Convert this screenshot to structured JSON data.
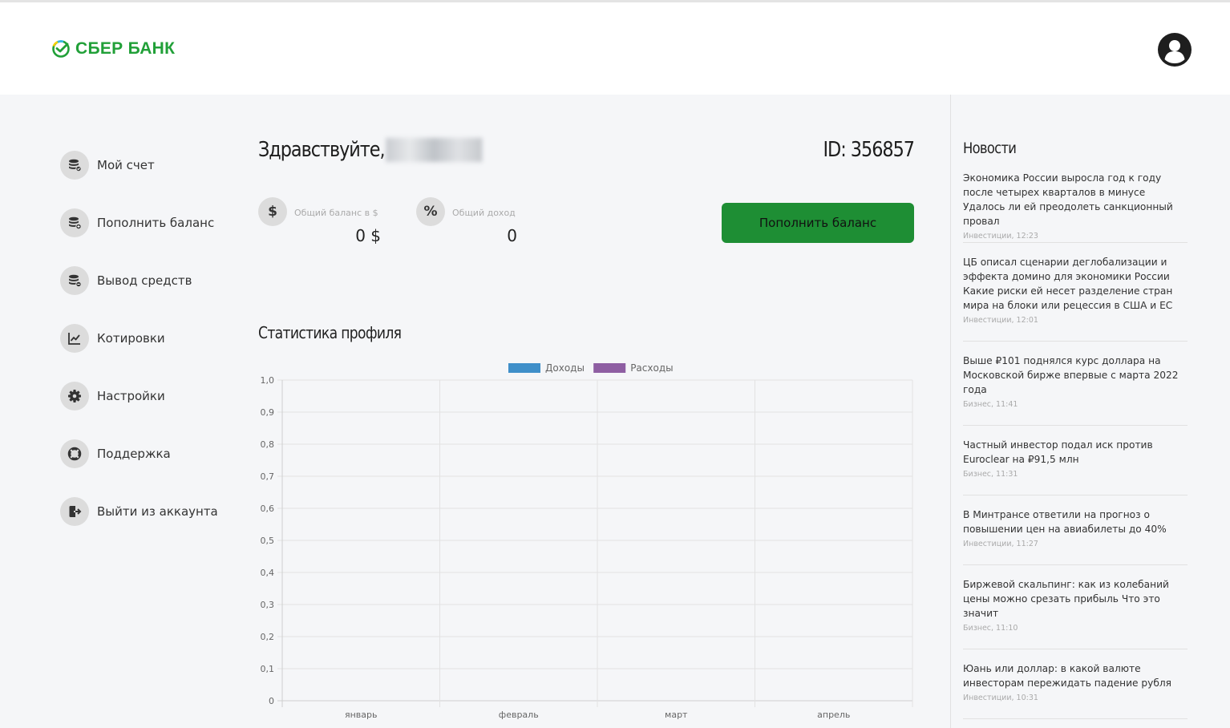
{
  "header": {
    "brand": "СБЕР БАНК",
    "brand_color": "#21a038",
    "avatar_icon": "user-avatar-icon"
  },
  "sidebar": {
    "items": [
      {
        "label": "Мой счет",
        "icon": "coins-icon"
      },
      {
        "label": "Пополнить баланс",
        "icon": "coins-plus-icon"
      },
      {
        "label": "Вывод средств",
        "icon": "coins-minus-icon"
      },
      {
        "label": "Котировки",
        "icon": "chart-line-icon"
      },
      {
        "label": "Настройки",
        "icon": "gear-icon"
      },
      {
        "label": "Поддержка",
        "icon": "lifebuoy-icon"
      },
      {
        "label": "Выйти из аккаунта",
        "icon": "logout-icon"
      }
    ]
  },
  "main": {
    "greeting": "Здравствуйте,",
    "user_id": "ID: 356857",
    "balance": {
      "icon_glyph": "$",
      "label": "Общий баланс в $",
      "value": "0 $"
    },
    "income": {
      "icon_glyph": "%",
      "label": "Общий доход",
      "value": "0"
    },
    "topup_button": "Пополнить баланс",
    "topup_color": "#1e8e34",
    "stats_title": "Статистика профиля"
  },
  "chart_data": {
    "type": "bar",
    "categories": [
      "январь",
      "февраль",
      "март",
      "апрель"
    ],
    "series": [
      {
        "name": "Доходы",
        "color": "#3f8fc9",
        "values": [
          0,
          0,
          0,
          0
        ]
      },
      {
        "name": "Расходы",
        "color": "#8e5ea2",
        "values": [
          0,
          0,
          0,
          0
        ]
      }
    ],
    "ylim": [
      0,
      1
    ],
    "yticks": [
      "0",
      "0,1",
      "0,2",
      "0,3",
      "0,4",
      "0,5",
      "0,6",
      "0,7",
      "0,8",
      "0,9",
      "1,0"
    ],
    "legend": "top",
    "grid": true
  },
  "news": {
    "title": "Новости",
    "items": [
      {
        "text": "Экономика России выросла год к году после четырех кварталов в минусе Удалось ли ей преодолеть санкционный провал",
        "meta": "Инвестиции, 12:23"
      },
      {
        "text": "ЦБ описал сценарии деглобализации и эффекта домино для экономики России Какие риски ей несет разделение стран мира на блоки или рецессия в США и ЕС",
        "meta": "Инвестиции, 12:01"
      },
      {
        "text": "Выше ₽101 поднялся курс доллара на Московской бирже впервые с марта 2022 года",
        "meta": "Бизнес, 11:41"
      },
      {
        "text": "Частный инвестор подал иск против Euroclear на ₽91,5 млн",
        "meta": "Бизнес, 11:31"
      },
      {
        "text": "В Минтрансе ответили на прогноз о повышении цен на авиабилеты до 40%",
        "meta": "Инвестиции, 11:27"
      },
      {
        "text": "Биржевой скальпинг: как из колебаний цены можно срезать прибыль Что это значит",
        "meta": "Бизнес, 11:10"
      },
      {
        "text": "Юань или доллар: в какой валюте инвесторам пережидать падение рубля",
        "meta": "Инвестиции, 10:31"
      }
    ]
  }
}
